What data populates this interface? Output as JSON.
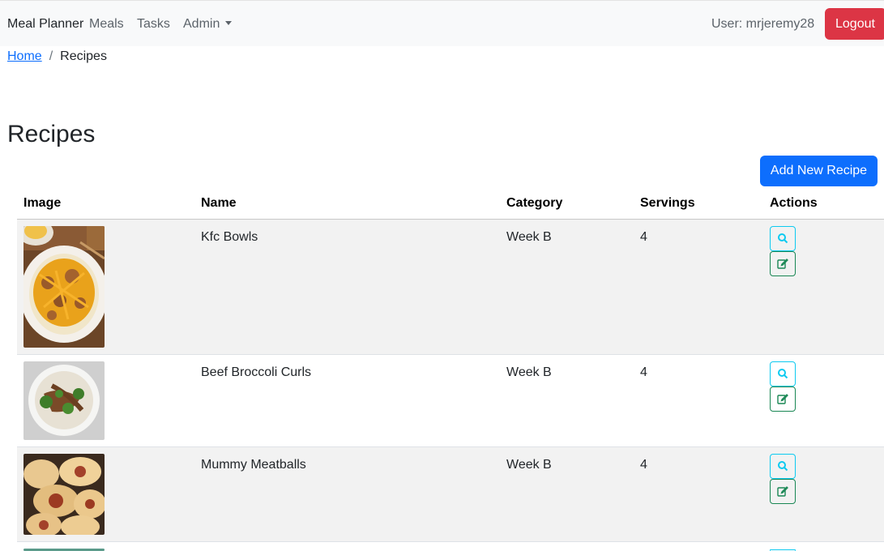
{
  "navbar": {
    "brand": "Meal Planner",
    "links": [
      "Meals",
      "Tasks",
      "Admin"
    ],
    "user_text": "User: mrjeremy28",
    "logout_label": "Logout"
  },
  "breadcrumb": {
    "home": "Home",
    "separator": "/",
    "current": "Recipes"
  },
  "page": {
    "title": "Recipes",
    "add_button": "Add New Recipe"
  },
  "table": {
    "headers": [
      "Image",
      "Name",
      "Category",
      "Servings",
      "Actions"
    ],
    "rows": [
      {
        "name": "Kfc Bowls",
        "category": "Week B",
        "servings": "4"
      },
      {
        "name": "Beef Broccoli Curls",
        "category": "Week B",
        "servings": "4"
      },
      {
        "name": "Mummy Meatballs",
        "category": "Week B",
        "servings": "4"
      },
      {
        "name": "",
        "category": "",
        "servings": ""
      }
    ]
  },
  "colors": {
    "navbar_bg": "#f8f9fa",
    "logout_bg": "#dc3545",
    "primary": "#0d6efd",
    "view_outline": "#0dcaf0",
    "edit_outline": "#198754",
    "stripe": "#f2f2f2"
  },
  "icons": {
    "view": "search-icon",
    "edit": "edit-icon"
  }
}
